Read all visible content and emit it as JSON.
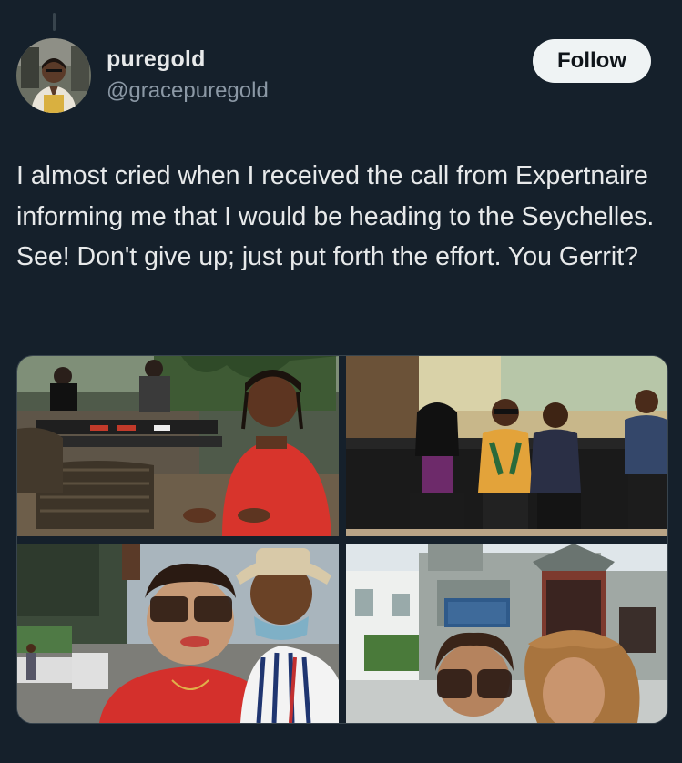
{
  "author": {
    "display_name": "puregold",
    "handle": "@gracepuregold",
    "avatar_icon": "user-avatar-photo"
  },
  "follow_button": {
    "label": "Follow"
  },
  "tweet": {
    "text": "I almost cried when I received the call from Expertnaire informing me that I would be heading to the Seychelles. See! Don't give up; just put forth the effort. You Gerrit?"
  },
  "media": {
    "photos": [
      {
        "icon": "restaurant-photo"
      },
      {
        "icon": "group-sofa-photo"
      },
      {
        "icon": "selfie-street-photo"
      },
      {
        "icon": "temple-selfie-photo"
      }
    ]
  },
  "colors": {
    "background": "#15202b",
    "text_primary": "#e7e9ea",
    "text_secondary": "#8b98a5",
    "button_bg": "#eff3f4",
    "button_text": "#0f1419",
    "border": "#38444d"
  }
}
